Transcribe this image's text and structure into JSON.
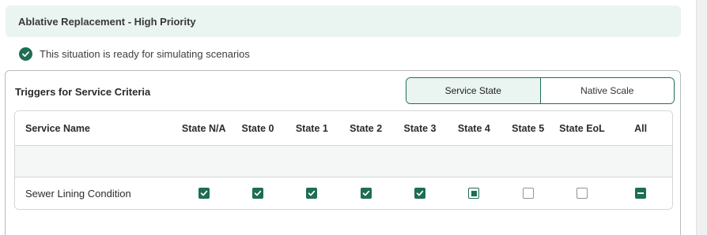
{
  "header": {
    "title": "Ablative Replacement - High Priority"
  },
  "status": {
    "message": "This situation is ready for simulating scenarios",
    "icon": "check-circle-icon"
  },
  "triggers": {
    "title": "Triggers for Service Criteria",
    "toggle": {
      "options": [
        "Service State",
        "Native Scale"
      ],
      "selected": "Service State"
    },
    "columns": [
      "Service Name",
      "State N/A",
      "State 0",
      "State 1",
      "State 2",
      "State 3",
      "State 4",
      "State 5",
      "State EoL",
      "All"
    ],
    "rows": [
      {
        "name": "Sewer Lining Condition",
        "states": [
          "checked",
          "checked",
          "checked",
          "checked",
          "checked",
          "partial",
          "unchecked",
          "unchecked"
        ],
        "all": "indeterminate"
      }
    ]
  },
  "colors": {
    "accent": "#1e6e51",
    "header_bg": "#eaf4f1"
  }
}
